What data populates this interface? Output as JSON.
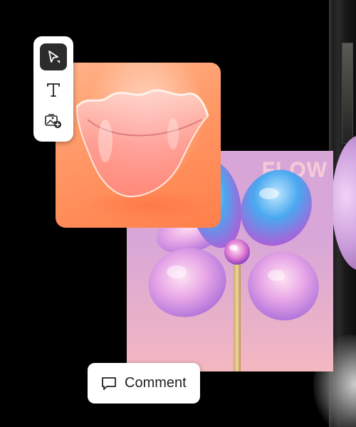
{
  "toolbar": {
    "tools": [
      {
        "icon": "select-arrow-icon",
        "selected": true
      },
      {
        "icon": "text-tool-icon",
        "label": "T",
        "selected": false
      },
      {
        "icon": "add-image-icon",
        "selected": false
      }
    ]
  },
  "canvas": {
    "flower_card_text": "FLOW"
  },
  "comment_button": {
    "label": "Comment",
    "icon": "comment-bubble-icon"
  },
  "colors": {
    "background": "#000000",
    "toolbar_bg": "#ffffff",
    "selected_tool_bg": "#2c2c2c",
    "bowl_card_bg": "#ff9866",
    "flower_card_bg": "#d8a7d8",
    "flow_text": "#f6c9d8"
  }
}
